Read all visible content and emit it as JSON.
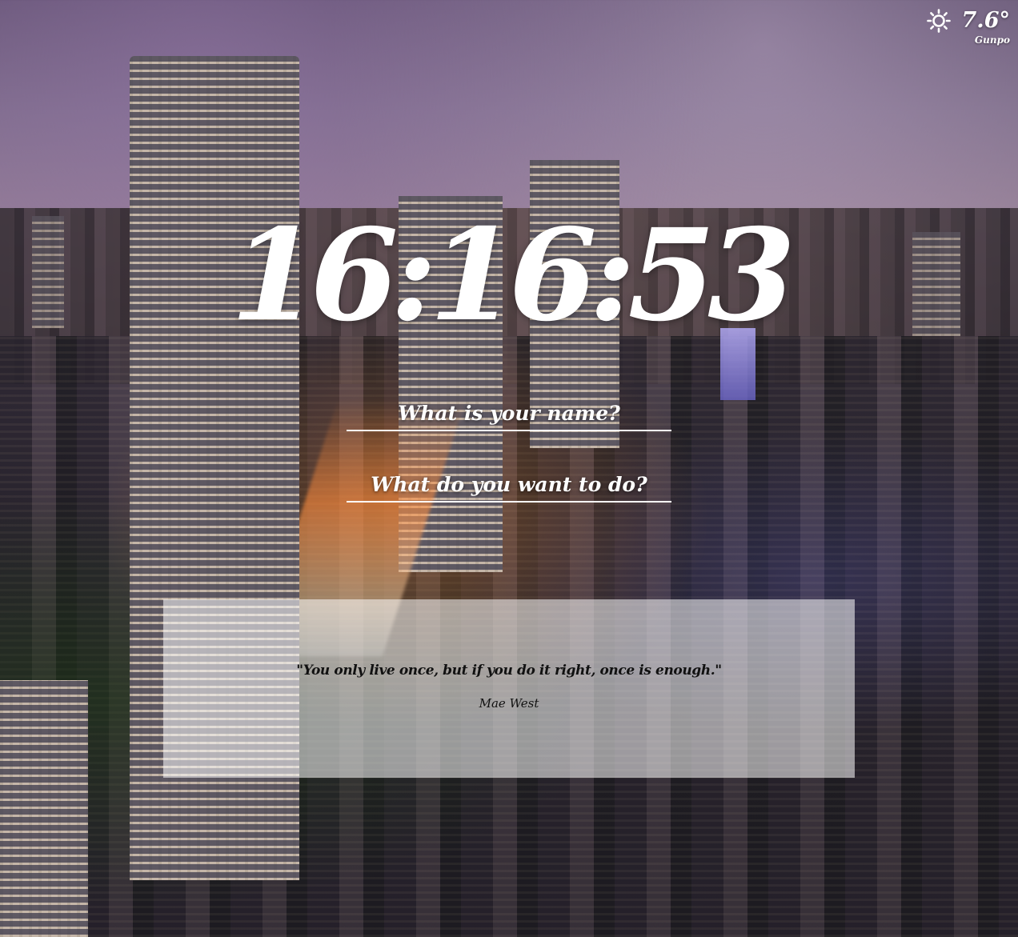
{
  "weather": {
    "icon": "sun-icon",
    "temperature": "7.6°",
    "city": "Gunpo"
  },
  "clock": {
    "time": "16:16:53"
  },
  "inputs": {
    "name_placeholder": "What is your name?",
    "todo_placeholder": "What do you want to do?"
  },
  "quote": {
    "text": "\"You only live once, but if you do it right, once is enough.\"",
    "author": "Mae West"
  }
}
